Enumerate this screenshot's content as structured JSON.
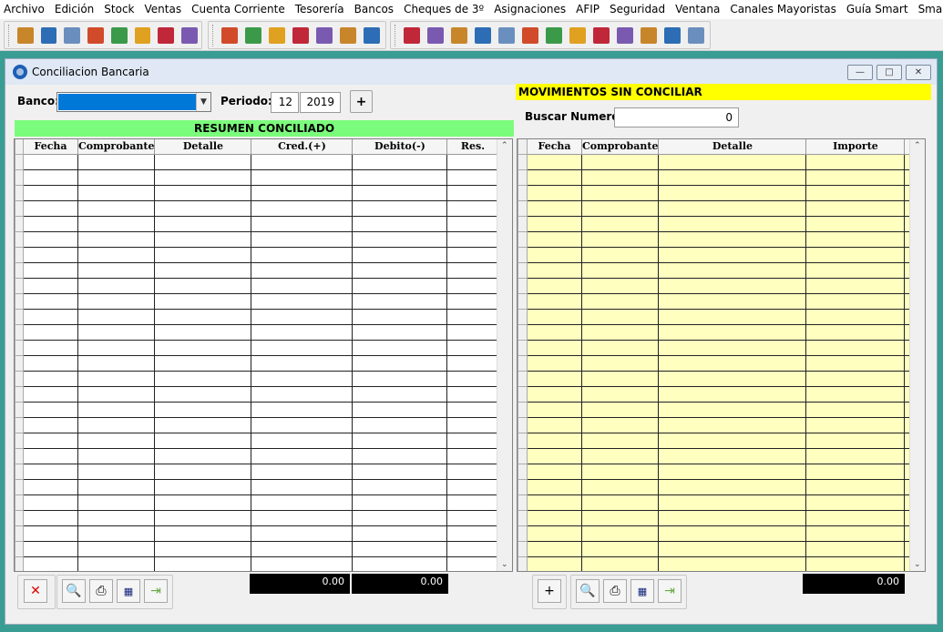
{
  "menu": [
    "Archivo",
    "Edición",
    "Stock",
    "Ventas",
    "Cuenta Corriente",
    "Tesorería",
    "Bancos",
    "Cheques de 3º",
    "Asignaciones",
    "AFIP",
    "Seguridad",
    "Ventana",
    "Canales Mayoristas",
    "Guía Smart",
    "Smart Coach"
  ],
  "toolbar": {
    "group1": [
      "calc-icon",
      "spreadsheet-icon",
      "clipboard-icon",
      "notepad-icon",
      "chart-icon",
      "report-icon",
      "document-icon",
      "settings-document-icon"
    ],
    "group2": [
      "card-yellow-icon",
      "card-gray-icon",
      "card-orange-icon",
      "card-red-icon",
      "box-green-icon",
      "box-orange-icon",
      "box-red-icon"
    ],
    "group3": [
      "user-icon",
      "money-icon",
      "key-icon",
      "search-icon",
      "refresh-document-icon",
      "bank-icon",
      "cash-icon",
      "bill-icon",
      "cash-register-icon",
      "op-icon",
      "ticket-icon",
      "bell-icon",
      "power-icon"
    ]
  },
  "window": {
    "title": "Conciliacion Bancaria",
    "banco_label": "Banco:",
    "periodo_label": "Periodo:",
    "periodo_month": "12",
    "periodo_year": "2019",
    "resumen_header": "RESUMEN CONCILIADO",
    "resumen_columns": [
      "Fecha",
      "Comprobante",
      "Detalle",
      "Cred.(+)",
      "Debito(-)",
      "Res."
    ],
    "resumen_total_credito": "0.00",
    "resumen_total_debito": "0.00",
    "movimientos_header": "MOVIMIENTOS SIN CONCILIAR",
    "buscar_label": "Buscar Numero:",
    "buscar_value": "0",
    "movimientos_columns": [
      "Fecha",
      "Comprobante",
      "Detalle",
      "Importe"
    ],
    "movimientos_total": "0.00",
    "colors": {
      "resumen_header_bg": "#7cfc7c",
      "movimientos_header_bg": "#ffff00",
      "movimientos_grid_bg": "#ffffc0",
      "banco_selected": "#0078d7"
    }
  }
}
